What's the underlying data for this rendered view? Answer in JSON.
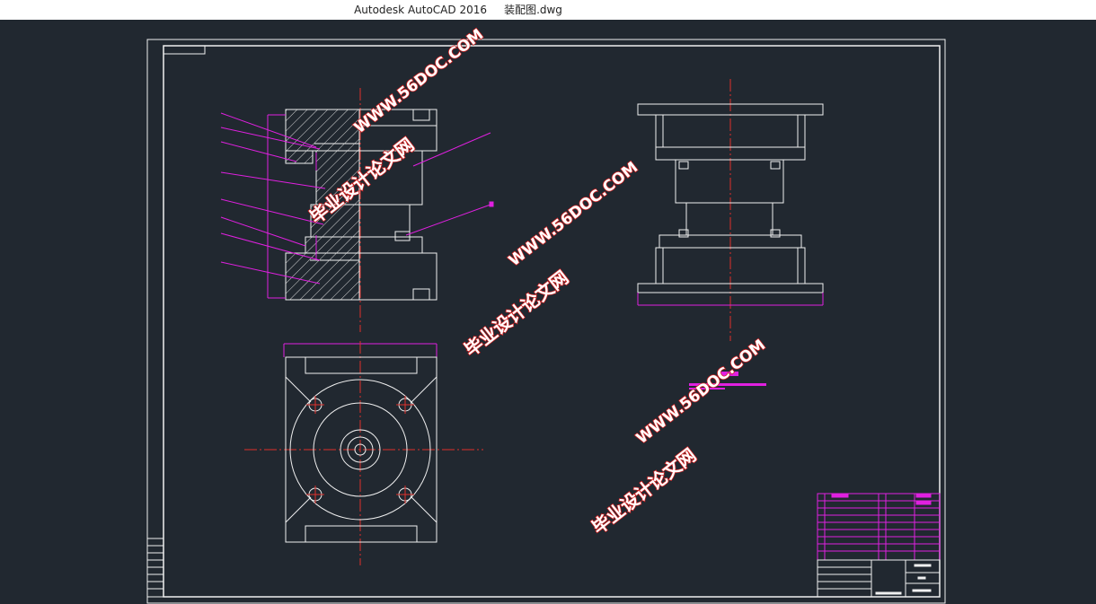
{
  "window": {
    "app_title": "Autodesk AutoCAD 2016",
    "file_name": "装配图.dwg"
  },
  "watermarks": [
    {
      "line1": "毕业设计论文网",
      "line2": "WWW.56DOC.COM"
    },
    {
      "line1": "毕业设计论文网",
      "line2": "WWW.56DOC.COM"
    },
    {
      "line1": "毕业设计论文网",
      "line2": "WWW.56DOC.COM"
    }
  ],
  "colors": {
    "background": "#212830",
    "white_line": "#f0f0f0",
    "center_line": "#e0302a",
    "annotation": "#e020e0",
    "titlebar": "#ffffff"
  }
}
